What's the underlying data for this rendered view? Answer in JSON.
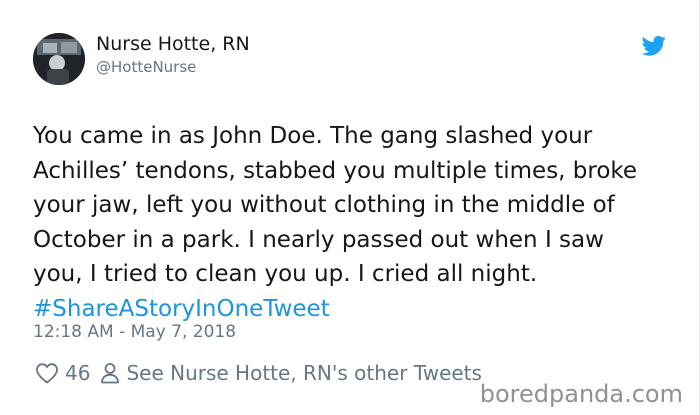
{
  "user": {
    "display_name": "Nurse Hotte, RN",
    "handle": "@HotteNurse"
  },
  "tweet": {
    "body": "You came in as John Doe. The gang slashed your\nAchilles’ tendons, stabbed you multiple times, broke\nyour jaw, left you without clothing in the middle of\nOctober in a park. I nearly passed out when I saw\nyou, I tried to clean you up. I cried all night.\n",
    "hashtag": "#ShareAStoryInOneTweet",
    "timestamp": "12:18 AM - May 7, 2018"
  },
  "actions": {
    "like_count": "46",
    "other_tweets_label": "See Nurse Hotte, RN's other Tweets"
  },
  "watermark": "boredpanda.com",
  "colors": {
    "brand_blue": "#1da1f2",
    "hashtag": "#1b95e0",
    "secondary_text": "#657786",
    "primary_text": "#14171a"
  },
  "icons": {
    "brand": "twitter-bird-icon",
    "like": "heart-icon",
    "profile": "person-icon"
  }
}
